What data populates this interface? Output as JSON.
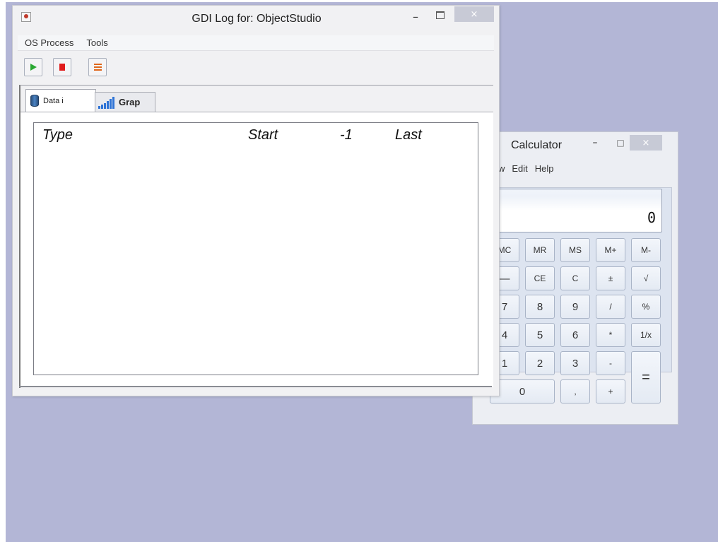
{
  "gdi_window": {
    "title": "GDI Log for: ObjectStudio",
    "min_glyph": "–",
    "close_glyph": "×",
    "menu": [
      "OS Process",
      "Tools"
    ],
    "tabs": {
      "data_label": "Data i",
      "graph_label": "Grap"
    },
    "columns": [
      "Type",
      "Start",
      "-1",
      "Last"
    ]
  },
  "calculator": {
    "title": "Calculator",
    "min_glyph": "–",
    "max_glyph": "□",
    "close_glyph": "×",
    "menu": [
      "w",
      "Edit",
      "Help"
    ],
    "display_value": "0",
    "keys": {
      "mc": "MC",
      "mr": "MR",
      "ms": "MS",
      "mplus": "M+",
      "mminus": "M-",
      "backspace": "—",
      "ce": "CE",
      "c": "C",
      "plusminus": "±",
      "sqrt": "√",
      "seven": "7",
      "eight": "8",
      "nine": "9",
      "divide": "/",
      "percent": "%",
      "four": "4",
      "five": "5",
      "six": "6",
      "multiply": "*",
      "reciprocal": "1/x",
      "one": "1",
      "two": "2",
      "three": "3",
      "subtract": "-",
      "zero": "0",
      "decimal": ",",
      "add": "+",
      "equals": "="
    }
  },
  "colors": {
    "desktop": "#b3b6d6",
    "play": "#2aa832",
    "stop": "#e01b1b",
    "list": "#e0661b"
  }
}
